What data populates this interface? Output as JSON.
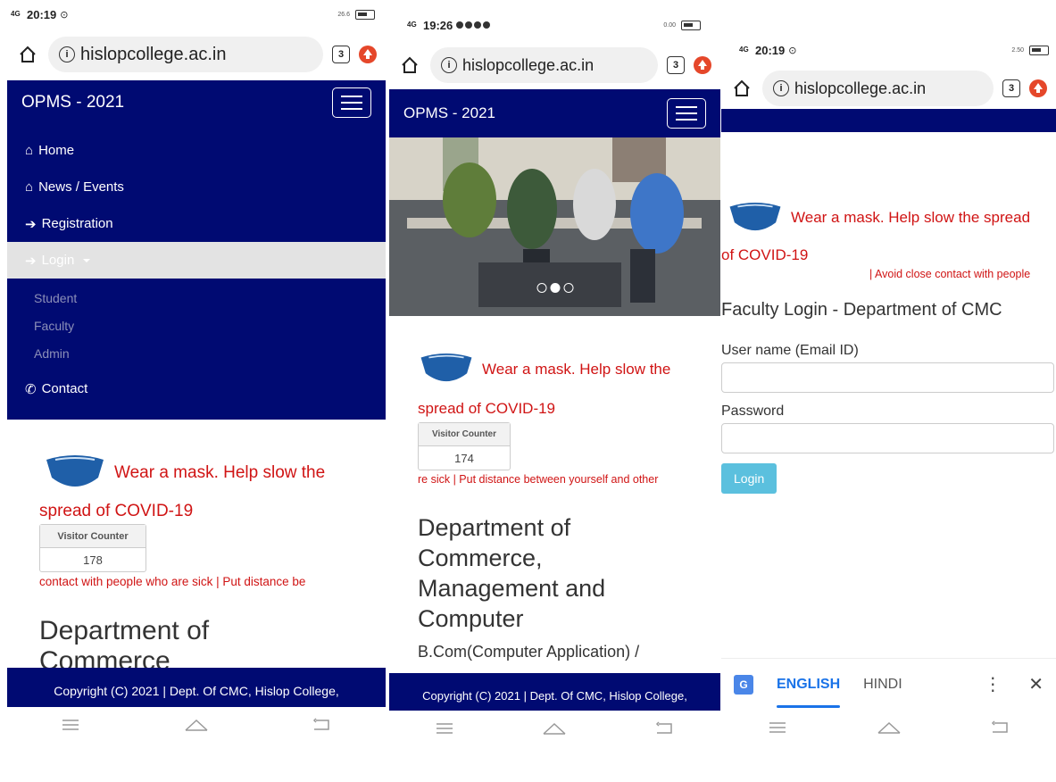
{
  "colors": {
    "navbar": "#000a72",
    "alert_red": "#d01414",
    "login_button": "#5bc0de",
    "translate_accent": "#1a73e8"
  },
  "icons": [
    "home-icon",
    "info-icon",
    "tabs-icon",
    "opera-icon",
    "menu-toggle-icon",
    "house-icon",
    "sign-in-icon",
    "phone-icon",
    "mask-icon",
    "translate-icon",
    "more-vert-icon",
    "close-icon"
  ],
  "phone1": {
    "status": {
      "network": "4G",
      "time": "20:19",
      "speed": "26.6"
    },
    "url": {
      "domain": "hislopcollege.ac.in",
      "tab_count": "3"
    },
    "brand": "OPMS - 2021",
    "menu": {
      "home": "Home",
      "news": "News / Events",
      "registration": "Registration",
      "login": "Login",
      "student": "Student",
      "faculty": "Faculty",
      "admin": "Admin",
      "contact": "Contact"
    },
    "alert_line1": "Wear a mask. Help slow the",
    "alert_line2": "spread of COVID-19",
    "counter_label": "Visitor Counter",
    "counter_value": "178",
    "marquee": "contact with people who are sick | Put distance be",
    "dept_title": "Department of Commerce",
    "footer": "Copyright (C) 2021 | Dept. Of CMC, Hislop College,"
  },
  "phone2": {
    "status": {
      "network": "4G",
      "time": "19:26",
      "speed": "0.00"
    },
    "url": {
      "domain": "hislopcollege.ac.in",
      "tab_count": "3"
    },
    "brand": "OPMS - 2021",
    "alert_line1": "Wear a mask. Help slow the",
    "alert_line2": "spread of COVID-19",
    "counter_label": "Visitor Counter",
    "counter_value": "174",
    "marquee": "re sick | Put distance between yourself and other",
    "dept_title": "Department of Commerce, Management and Computer",
    "dept_sub": "B.Com(Computer Application) /",
    "footer": "Copyright (C) 2021 | Dept. Of CMC, Hislop College,"
  },
  "phone3": {
    "status": {
      "network": "4G",
      "time": "20:19",
      "speed": "2.50"
    },
    "url": {
      "domain": "hislopcollege.ac.in",
      "tab_count": "3"
    },
    "alert_line1": "Wear a mask. Help slow the spread",
    "alert_line2": "of COVID-19",
    "marquee": "| Avoid close contact with people",
    "login_title": "Faculty Login - Department of CMC",
    "username_label": "User name (Email ID)",
    "password_label": "Password",
    "login_button": "Login",
    "translate": {
      "lang_active": "ENGLISH",
      "lang_other": "HINDI"
    }
  }
}
